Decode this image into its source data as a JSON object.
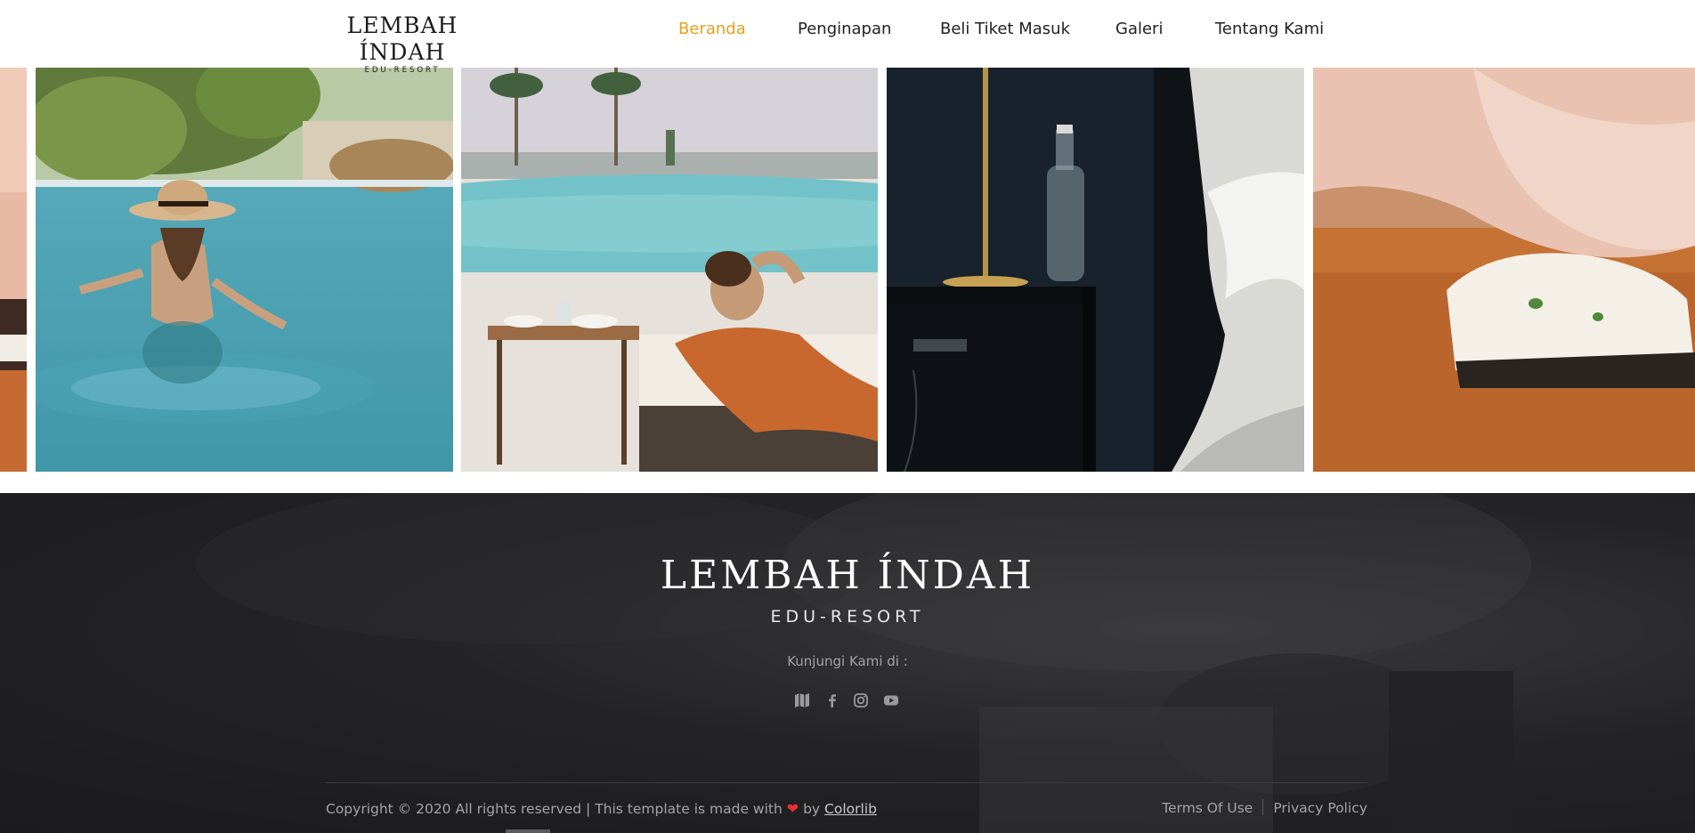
{
  "header": {
    "logo_main": "LEMBAH ÍNDAH",
    "logo_sub": "EDU-RESORT",
    "nav": [
      {
        "label": "Beranda",
        "active": true
      },
      {
        "label": "Penginapan",
        "active": false
      },
      {
        "label": "Beli Tiket Masuk",
        "active": false
      },
      {
        "label": "Galeri",
        "active": false
      },
      {
        "label": "Tentang Kami",
        "active": false
      }
    ],
    "accent_color": "#e5a11d"
  },
  "gallery": {
    "photos": [
      {
        "name": "sushi-photo-partial"
      },
      {
        "name": "woman-in-pool-photo"
      },
      {
        "name": "poolside-lounge-photo"
      },
      {
        "name": "bedroom-nightstand-photo"
      },
      {
        "name": "sushi-roll-photo"
      }
    ]
  },
  "footer": {
    "logo_main": "LEMBAH ÍNDAH",
    "logo_sub": "EDU-RESORT",
    "visit_label": "Kunjungi Kami di :",
    "social_icons": [
      "map-icon",
      "facebook-icon",
      "instagram-icon",
      "youtube-icon"
    ],
    "copyright_text": "Copyright © 2020 All rights reserved | This template is made with",
    "by_text": "by",
    "credit_link": "Colorlib",
    "links": [
      "Terms Of Use",
      "Privacy Policy"
    ],
    "heart_color": "#e53131"
  }
}
